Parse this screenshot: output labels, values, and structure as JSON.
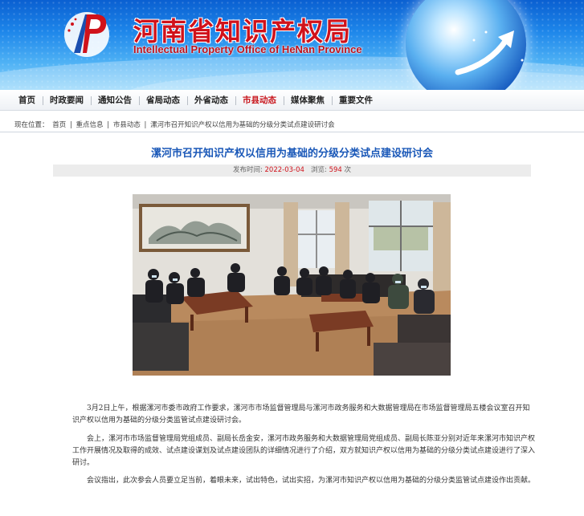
{
  "header": {
    "title_cn": "河南省知识产权局",
    "title_en": "Intellectual Property Office of HeNan Province",
    "emblem_icon": "ip-office-emblem-icon",
    "globe_icon": "globe-icon",
    "colors": {
      "title": "#d0121b",
      "banner": "#1d86ea"
    }
  },
  "nav": {
    "items": [
      {
        "label": "首页"
      },
      {
        "label": "时政要闻"
      },
      {
        "label": "通知公告"
      },
      {
        "label": "省局动态"
      },
      {
        "label": "外省动态"
      },
      {
        "label": "市县动态"
      },
      {
        "label": "媒体聚焦"
      },
      {
        "label": "重要文件"
      }
    ],
    "active_label": "市县动态",
    "active_color": "#c8161d"
  },
  "breadcrumb": {
    "prefix": "现在位置：",
    "items": [
      "首页",
      "重点信息",
      "市县动态",
      "漯河市召开知识产权以信用为基础的分级分类试点建设研讨会"
    ],
    "separator": " | "
  },
  "article": {
    "title": "漯河市召开知识产权以信用为基础的分级分类试点建设研讨会",
    "meta": {
      "date_label": "发布时间:",
      "date": "2022-03-04",
      "views_label": "浏览:",
      "views": "594",
      "views_unit": "次"
    },
    "photo_alt": "meeting-photo",
    "paragraphs": [
      "3月2日上午，根据漯河市委市政府工作要求，漯河市市场监督管理局与漯河市政务服务和大数据管理局在市场监督管理局五楼会议室召开知识产权以信用为基础的分级分类监管试点建设研讨会。",
      "会上，漯河市市场监督管理局党组成员、副局长岳金安，漯河市政务服务和大数据管理局党组成员、副局长陈亚分别对近年来漯河市知识产权工作开展情况及取得的成效、试点建设谋划及试点建设团队的详细情况进行了介绍，双方就知识产权以信用为基础的分级分类试点建设进行了深入研讨。",
      "会议指出，此次参会人员要立足当前，着眼未来，试出特色，试出实招，为漯河市知识产权以信用为基础的分级分类监管试点建设作出贡献。"
    ]
  }
}
